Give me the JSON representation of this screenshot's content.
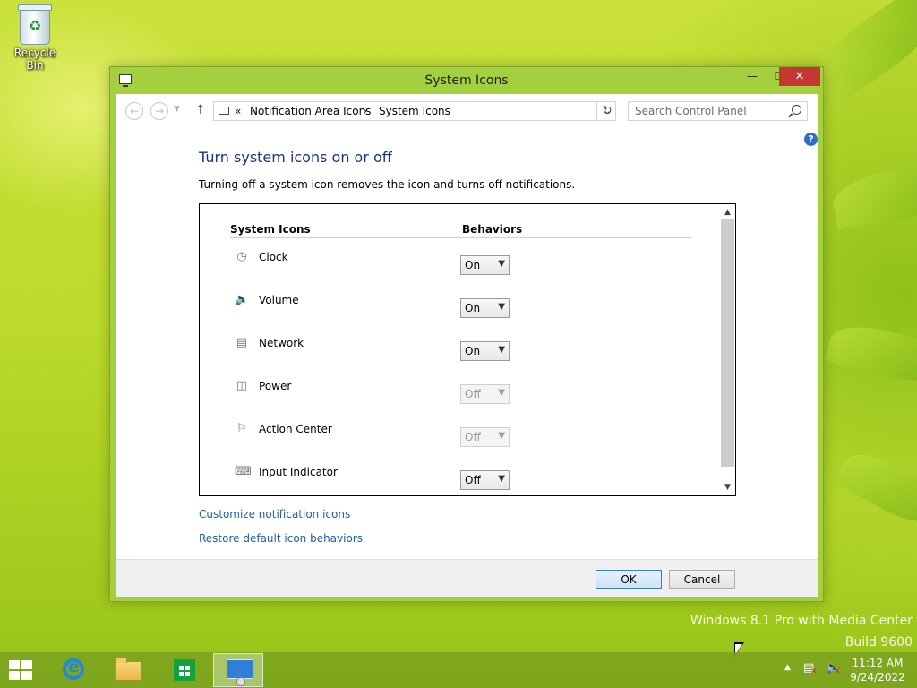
{
  "desktop": {
    "recycle_bin_label": "Recycle Bin",
    "watermark_line1": "Windows 8.1 Pro with Media Center",
    "watermark_line2": "Build 9600"
  },
  "window": {
    "title": "System Icons",
    "buttons": {
      "minimize": "—",
      "maximize": "☐",
      "close": "✕"
    }
  },
  "nav": {
    "breadcrumb_sep": "«",
    "breadcrumb": [
      "Notification Area Icons",
      "System Icons"
    ],
    "search_placeholder": "Search Control Panel"
  },
  "content": {
    "heading": "Turn system icons on or off",
    "description": "Turning off a system icon removes the icon and turns off notifications.",
    "columns": {
      "icons": "System Icons",
      "behaviors": "Behaviors"
    },
    "rows": [
      {
        "name": "Clock",
        "icon": "clock-icon",
        "value": "On",
        "enabled": true
      },
      {
        "name": "Volume",
        "icon": "volume-icon",
        "value": "On",
        "enabled": true
      },
      {
        "name": "Network",
        "icon": "network-icon",
        "value": "On",
        "enabled": true
      },
      {
        "name": "Power",
        "icon": "power-icon",
        "value": "Off",
        "enabled": false
      },
      {
        "name": "Action Center",
        "icon": "flag-icon",
        "value": "Off",
        "enabled": false
      },
      {
        "name": "Input Indicator",
        "icon": "keyboard-icon",
        "value": "Off",
        "enabled": true
      }
    ],
    "links": [
      "Customize notification icons",
      "Restore default icon behaviors"
    ]
  },
  "footer": {
    "ok": "OK",
    "cancel": "Cancel"
  },
  "taskbar": {
    "time": "11:12 AM",
    "date": "9/24/2022"
  },
  "colors": {
    "heading": "#1e3287",
    "link": "#1e5ea8",
    "close_button": "#c7372f",
    "window_frame": "#a4cf3e"
  }
}
